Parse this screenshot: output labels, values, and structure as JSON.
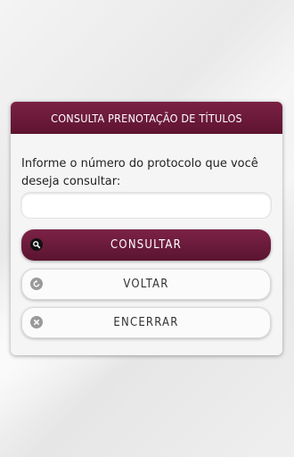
{
  "header": {
    "title": "CONSULTA PRENOTAÇÃO DE TÍTULOS"
  },
  "form": {
    "prompt": "Informe o número do protocolo que você deseja consultar:",
    "protocol_value": "",
    "protocol_placeholder": ""
  },
  "buttons": {
    "consultar": {
      "label": "CONSULTAR",
      "icon": "search-icon"
    },
    "voltar": {
      "label": "VOLTAR",
      "icon": "back-icon"
    },
    "encerrar": {
      "label": "ENCERRAR",
      "icon": "close-icon"
    }
  },
  "colors": {
    "brand": "#6b1a3a",
    "card_bg": "#f5f5f5"
  }
}
